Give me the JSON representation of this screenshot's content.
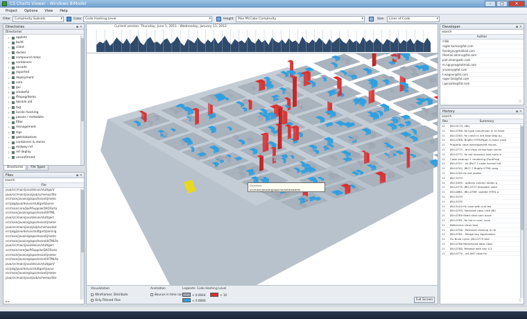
{
  "window": {
    "title": "CS Charts Viewer - Windows BiModel"
  },
  "menu": [
    "Project",
    "Options",
    "View",
    "Help"
  ],
  "toolbar": {
    "filter_label": "Filter",
    "filter_value": "Complexity Subsets",
    "color_label": "Color",
    "color_value": "Code Hashing Level",
    "height_label": "Height",
    "height_value": "Max McCabe Complexity",
    "size_label": "Size",
    "size_value": "Lines of Code"
  },
  "directories": {
    "title": "Directories",
    "header": "Directories",
    "items": [
      "applets",
      "build",
      "client",
      "docker",
      "compound mdoc",
      "containers",
      "encode",
      "exported",
      "deployment",
      "core",
      "gui",
      "smokeful",
      "ffmpeg/demo",
      "twinkle old",
      "tag",
      "locale mocking",
      "passes / metadata",
      "filter",
      "management",
      "sigs",
      "gwt/datastore",
      "containers & stores",
      "midway ref",
      "ref deploy",
      "unconfirmed"
    ]
  },
  "lower_tabs": {
    "tab1": "Directories",
    "tab2": "File Types"
  },
  "files": {
    "title": "Files",
    "search": "search",
    "column": "File",
    "rows": [
      "java/src/main/java/de/uni/stuttgart/",
      "java/src/main/java/jaxb/schemas/Sto",
      "src/main/java/org/apache/ant/jmeter",
      "src/pkg/java/de/uni/stuttgart/parse",
      "src/main/core/JaxP/SupplierDAOFacto",
      "src/main/java/org/apache/ant/HTML",
      "java/src/main/java/de/uni/stuttgart",
      "src/main/java/org/apache/ant/jmeter",
      "java/src/main/java/jaxb/schemas/dat",
      "src/pkg/java/de/uni/stuttgart/parsing",
      "src/main/java/org/apache/ant/jmeter",
      "src/main/java/org/apache/ant/HTMLPa",
      "java/src/main/java/de/uni/stuttgart",
      "src/main/core/JaxP/SupplierDAOFacto",
      "src/main/java/org/apache/ant/jmeter",
      "src/main/java/org/apache/ant/HTMLRe",
      "java/src/main/java/de/uni/stuttgart/",
      "src/pkg/java/de/uni/stuttgart/parse",
      "src/main/java/org/apache/ant/jmeter",
      "java/src/main/java/jaxb/schemas/Sto"
    ]
  },
  "timeline": {
    "caption": "Current version: Thursday, June 1, 2011 - Wednesday, January 11, 2012",
    "activity": [
      0.35,
      0.5,
      0.42,
      0.6,
      0.3,
      0.45,
      0.7,
      0.52,
      0.4,
      0.65,
      0.38,
      0.55,
      0.8,
      0.47,
      0.33,
      0.6,
      0.72,
      0.44,
      0.5,
      0.36,
      0.58,
      0.66,
      0.4,
      0.52,
      0.75,
      0.45,
      0.3,
      0.62,
      0.54,
      0.42,
      0.7,
      0.5,
      0.38,
      0.6,
      0.46,
      0.68,
      0.4,
      0.55,
      0.78,
      0.5,
      0.36,
      0.62,
      0.48,
      0.56,
      0.42,
      0.72,
      0.5,
      0.4,
      0.64,
      0.46,
      0.58,
      0.34,
      0.7,
      0.52,
      0.44,
      0.6,
      0.4,
      0.66,
      0.48,
      0.56,
      0.38,
      0.74,
      0.5,
      0.42,
      0.6,
      0.46,
      0.68,
      0.52,
      0.36,
      0.62,
      0.44,
      0.58,
      0.7,
      0.5,
      0.4,
      0.64,
      0.46,
      0.55,
      0.38,
      0.72,
      0.48,
      0.6,
      0.42,
      0.66,
      0.5,
      0.36,
      0.62,
      0.54,
      0.44,
      0.7,
      0.4,
      0.58,
      0.48,
      0.64,
      0.38,
      0.6,
      0.5,
      0.42,
      0.68,
      0.46
    ]
  },
  "tooltip": {
    "header": "Directory",
    "value": "src/main/java/org/apache/ant/taskdefs"
  },
  "legend": {
    "vis_title": "Visualization",
    "vis_opt1": "Wireframes: Distribute",
    "vis_opt2": "Only Filtered Files",
    "anim_title": "Animation",
    "anim_opt1": "Bounce in time range",
    "legend_title": "Legends: Code Hashing Level",
    "swatch1_label": "< 0.0044",
    "swatch2_label": "> 10",
    "swatch3_label": "< 0.0000",
    "color_gray": "#a0a8b4",
    "color_red": "#d83030",
    "color_blue": "#2f9fe0",
    "fullscreen": "Full Screen"
  },
  "developer": {
    "title": "Developer",
    "search": "search",
    "column": "Author",
    "authors": [
      "cdkb",
      "rogler.kumar@fat.com",
      "fandeyov@mikhail.com",
      "thomas.ahrens@fat.com",
      "piet.olsen@wtc.com",
      "m.nguyen@hotmail.com",
      "yrvaney@fat.com",
      "t.wagner@fat.com",
      "roger.fast@fat.com",
      "l.gonzales@fat.com"
    ]
  },
  "history": {
    "title": "History",
    "search": "search",
    "col_id": "Rev",
    "col_msg": "Summary",
    "rows": [
      [
        "11",
        "JBU-0113, n8q"
      ],
      [
        "11",
        "JBU-0788, fix type conversion in UI Save"
      ],
      [
        "11",
        "JBU-0785, fix crash in ant task stop pu"
      ],
      [
        "11",
        "JBU-0788, Bugfix HTMLPage in mavc prop"
      ],
      [
        "11",
        "Property save development issues"
      ],
      [
        "11",
        "JBU-0773 - ant-class string type conve"
      ],
      [
        "11",
        "JBU-0772, fix ant dynamic test suite b"
      ],
      [
        "11",
        "Code cleanup + rendering (FontProp"
      ],
      [
        "11",
        "JBU-0757 - fix JBU7-7 node format ind"
      ],
      [
        "11",
        "JBU-0702, JBU7-7 Bugfix HTML prop"
      ],
      [
        "11",
        "JBU-0700 fix ant jmeter"
      ],
      [
        "11",
        "JBU-5234"
      ],
      [
        "11",
        "JBU-5099 - options column widen p"
      ],
      [
        "11",
        "JBU-0775, JBU-0727 template valid"
      ],
      [
        "11",
        "JBU-0881, JBU-0769: update HTML p"
      ],
      [
        "11",
        "JBU-5233"
      ],
      [
        "11",
        "JBU-5235"
      ],
      [
        "11",
        "JBU-5104 fix case with null tes"
      ],
      [
        "11",
        "JBU-0793, Selected class click JBU"
      ],
      [
        "11",
        "JBU-0789 fixed class sort issue"
      ],
      [
        "11",
        "JBU-0781, fix list in core, scon"
      ],
      [
        "11",
        "Reference clean test"
      ],
      [
        "11",
        "JBU-0756 - Removal cleanup in ne"
      ],
      [
        "11",
        "JBU-0782 - Merge key Application"
      ],
      [
        "11",
        "Fix Build cycle: JBU-0773 test"
      ],
      [
        "11",
        "JBU-0786 Refactored data class"
      ],
      [
        "11",
        "JBU-0780, Release with key 4.3"
      ],
      [
        "11",
        "JBU-0779 - ref ANT code fix"
      ]
    ]
  }
}
